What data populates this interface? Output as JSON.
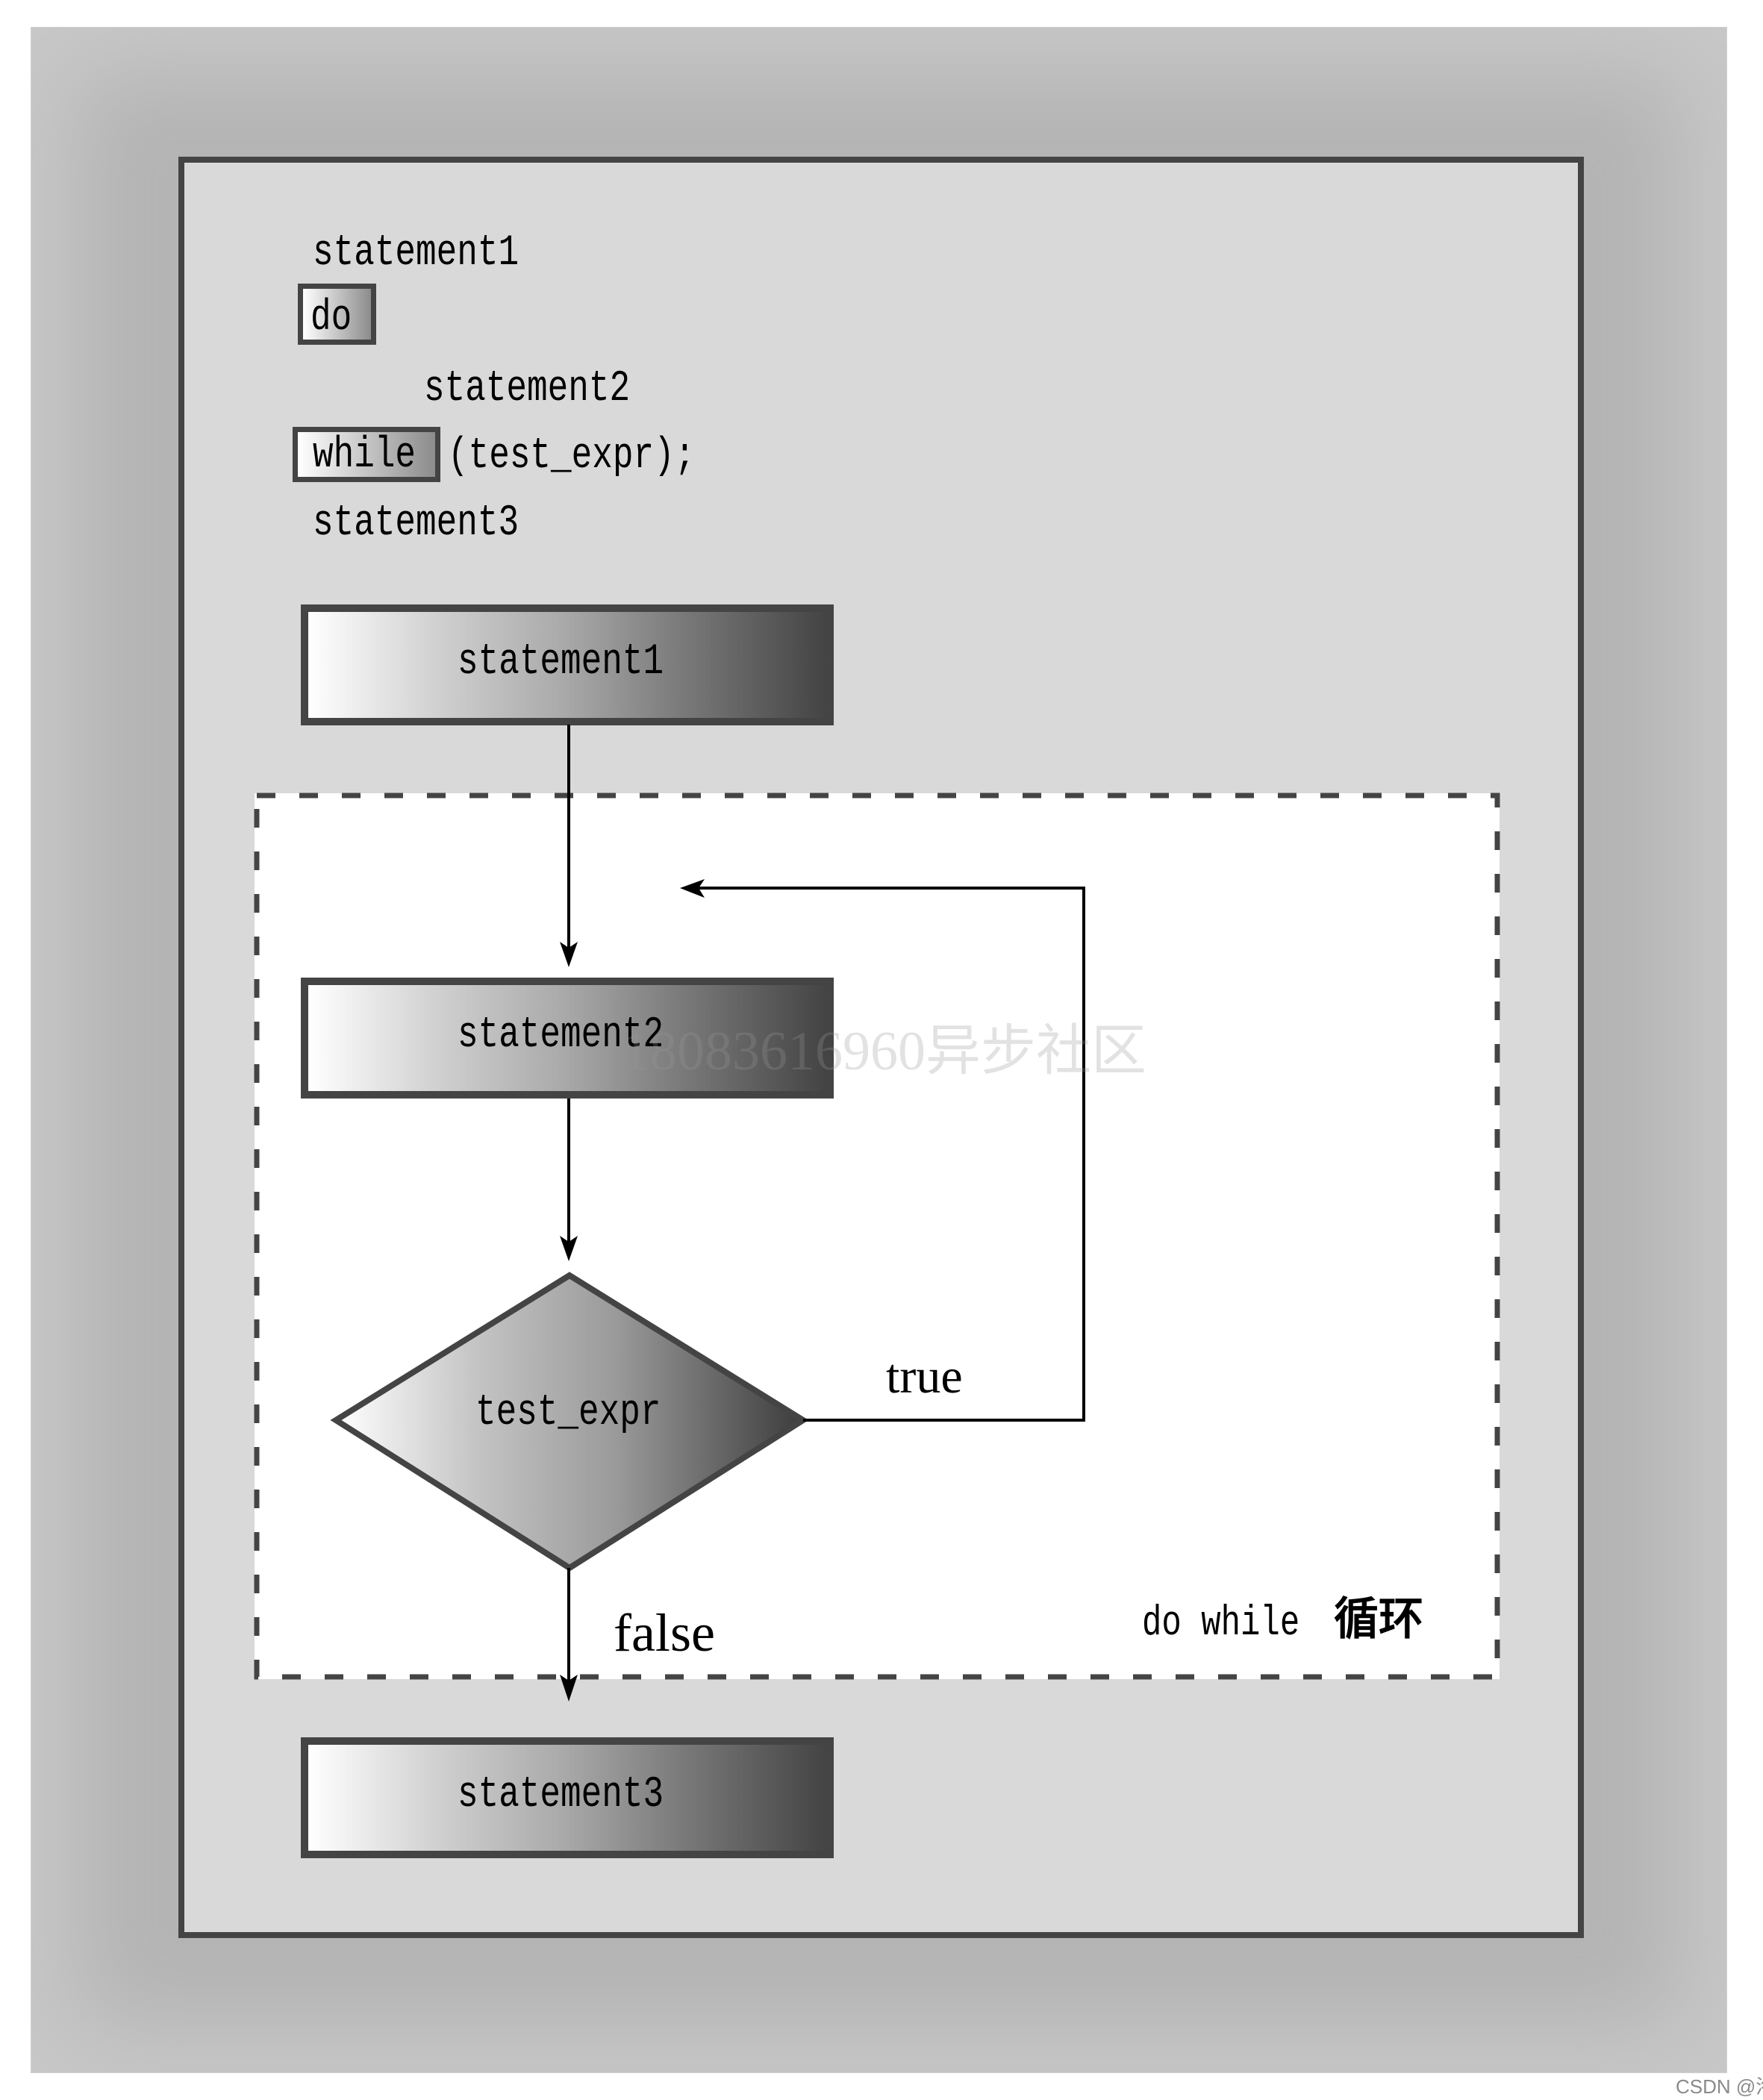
{
  "code": {
    "line1": "statement1",
    "do_keyword": "do",
    "line2": "statement2",
    "while_keyword": "while",
    "while_condition": "(test_expr);",
    "line3": "statement3"
  },
  "flowchart": {
    "box1_label": "statement1",
    "box2_label": "statement2",
    "decision_label": "test_expr",
    "true_label": "true",
    "false_label": "false",
    "box3_label": "statement3",
    "loop_caption_code": "do while",
    "loop_caption_cjk": "循环"
  },
  "watermarks": {
    "center": "18083616960异步社区",
    "corner": "CSDN @洛水鱼"
  },
  "colors": {
    "panel_fill": "#d9d9d9",
    "border": "#444444",
    "frame": "#b4b4b4",
    "loop_area": "#ffffff"
  }
}
